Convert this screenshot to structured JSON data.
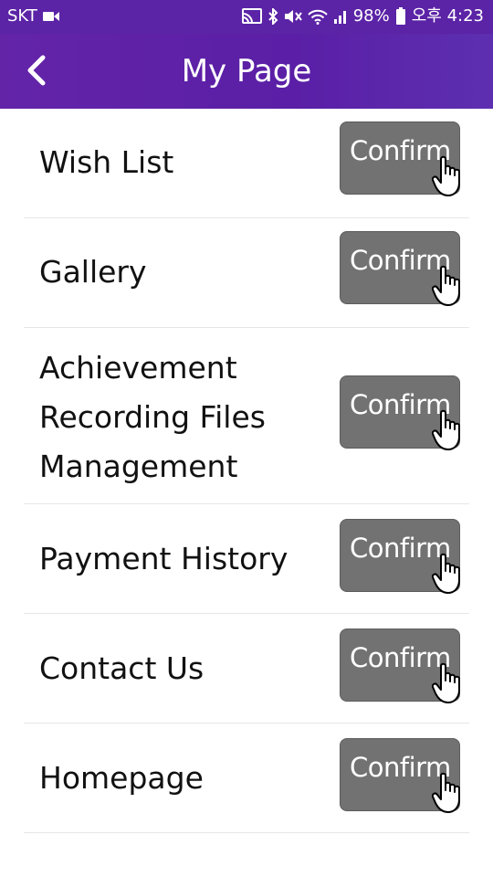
{
  "status_bar": {
    "carrier": "SKT",
    "battery": "98%",
    "time": "오후 4:23",
    "icons": [
      "video-camera-icon",
      "cast-icon",
      "bluetooth-icon",
      "mute-icon",
      "wifi-icon",
      "signal-icon",
      "battery-icon"
    ]
  },
  "header": {
    "back_icon": "back-arrow-icon",
    "title": "My Page"
  },
  "menu": {
    "items": [
      {
        "label": "Wish List",
        "button": "Confirm"
      },
      {
        "label": "Gallery",
        "button": "Confirm"
      },
      {
        "label": "Achievement\nRecording Files\nManagement",
        "button": "Confirm"
      },
      {
        "label": "Payment History",
        "button": "Confirm"
      },
      {
        "label": "Contact Us",
        "button": "Confirm"
      },
      {
        "label": "Homepage",
        "button": "Confirm"
      }
    ]
  },
  "colors": {
    "header": "#5b23a6",
    "button": "#727272",
    "divider": "#e6e6e6"
  }
}
